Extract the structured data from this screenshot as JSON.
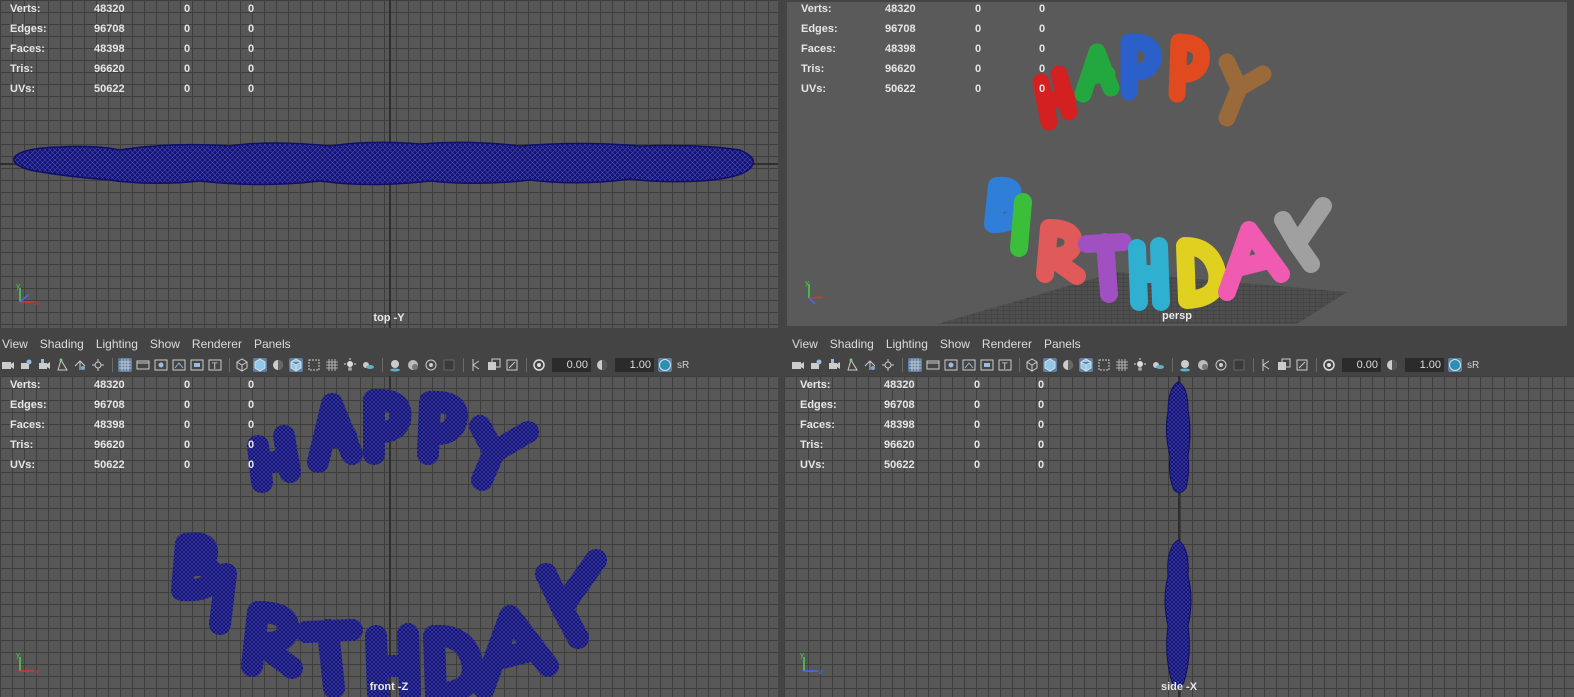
{
  "hud_labels": {
    "verts": "Verts:",
    "edges": "Edges:",
    "faces": "Faces:",
    "tris": "Tris:",
    "uvs": "UVs:"
  },
  "hud_stats": {
    "verts": [
      "48320",
      "0",
      "0"
    ],
    "edges": [
      "96708",
      "0",
      "0"
    ],
    "faces": [
      "48398",
      "0",
      "0"
    ],
    "tris": [
      "96620",
      "0",
      "0"
    ],
    "uvs": [
      "50622",
      "0",
      "0"
    ]
  },
  "menus": [
    "View",
    "Shading",
    "Lighting",
    "Show",
    "Renderer",
    "Panels"
  ],
  "toolbar": {
    "exposure_value": "0.00",
    "gamma_value": "1.00",
    "color_space_label": "sR"
  },
  "panels": {
    "top_left": {
      "camera": "top -Y"
    },
    "top_right": {
      "camera": "persp"
    },
    "bottom_left": {
      "camera": "front -Z"
    },
    "bottom_right": {
      "camera": "side -X"
    }
  },
  "model": {
    "word1": "HAPPY",
    "word2": "BIRTHDAY",
    "wire_color": "#1a1a8c",
    "balloon_colors": {
      "word1": [
        "#d42020",
        "#23a840",
        "#2b5fc9",
        "#e04a1e",
        "#9a6a3a"
      ],
      "word2": [
        "#2f7fd8",
        "#3bbf3b",
        "#e05a5a",
        "#a050c0",
        "#2fb0d0",
        "#e0d020",
        "#f05ab0",
        "#a0a0a0"
      ]
    }
  },
  "icons": {
    "axis_gizmo": "axis-gizmo-icon",
    "toolbar": [
      "camera-icon",
      "camera-attributes-icon",
      "bookmarks-icon",
      "image-plane-icon",
      "grid-icon",
      "film-gate-icon",
      "resolution-gate-icon",
      "gate-mask-icon",
      "field-chart-icon",
      "safe-action-icon",
      "safe-title-icon",
      "wireframe-icon",
      "smooth-shade-icon",
      "flat-shade-icon",
      "wireframe-on-shaded-icon",
      "xray-icon",
      "use-default-material-icon",
      "lights-icon",
      "shadows-icon",
      "ambient-occlusion-icon",
      "antialias-icon",
      "depth-of-field-icon",
      "isolate-select-icon",
      "xray-joints-icon",
      "xray-active-icon",
      "exposure-icon",
      "gamma-icon",
      "view-transform-icon"
    ]
  }
}
